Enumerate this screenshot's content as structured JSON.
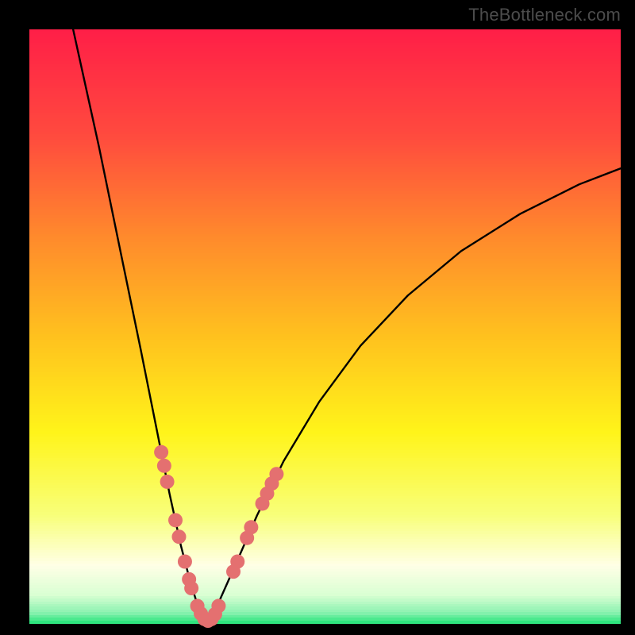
{
  "watermark": "TheBottleneck.com",
  "colors": {
    "frame": "#000000",
    "curve": "#000000",
    "dot": "#e47070",
    "bottom_bar": "#2fe57f"
  },
  "chart_data": {
    "type": "line",
    "title": "",
    "xlabel": "",
    "ylabel": "",
    "xlim": [
      0,
      100
    ],
    "ylim": [
      0,
      100
    ],
    "gradient_stops": [
      {
        "pos": 0.0,
        "color": "#ff1f47"
      },
      {
        "pos": 0.18,
        "color": "#ff4b3e"
      },
      {
        "pos": 0.35,
        "color": "#ff8a2c"
      },
      {
        "pos": 0.52,
        "color": "#ffc21e"
      },
      {
        "pos": 0.68,
        "color": "#fff41a"
      },
      {
        "pos": 0.82,
        "color": "#f8ff7a"
      },
      {
        "pos": 0.905,
        "color": "#ffffe6"
      },
      {
        "pos": 0.955,
        "color": "#d9ffd3"
      },
      {
        "pos": 0.985,
        "color": "#8af2b0"
      },
      {
        "pos": 1.0,
        "color": "#2fe57f"
      }
    ],
    "series": [
      {
        "name": "left_branch",
        "points": [
          {
            "x": 7.4,
            "y": 100.0
          },
          {
            "x": 11.8,
            "y": 80.0
          },
          {
            "x": 15.5,
            "y": 62.0
          },
          {
            "x": 18.8,
            "y": 46.0
          },
          {
            "x": 21.5,
            "y": 32.5
          },
          {
            "x": 23.7,
            "y": 21.5
          },
          {
            "x": 25.6,
            "y": 12.8
          },
          {
            "x": 27.2,
            "y": 6.6
          },
          {
            "x": 28.4,
            "y": 2.8
          },
          {
            "x": 29.4,
            "y": 0.8
          },
          {
            "x": 30.0,
            "y": 0.0
          }
        ]
      },
      {
        "name": "right_branch",
        "points": [
          {
            "x": 30.0,
            "y": 0.0
          },
          {
            "x": 32.2,
            "y": 3.5
          },
          {
            "x": 35.0,
            "y": 9.8
          },
          {
            "x": 38.5,
            "y": 17.8
          },
          {
            "x": 43.0,
            "y": 27.0
          },
          {
            "x": 49.0,
            "y": 37.0
          },
          {
            "x": 56.0,
            "y": 46.5
          },
          {
            "x": 64.0,
            "y": 55.0
          },
          {
            "x": 73.0,
            "y": 62.5
          },
          {
            "x": 83.0,
            "y": 68.8
          },
          {
            "x": 93.0,
            "y": 73.8
          },
          {
            "x": 100.0,
            "y": 76.5
          }
        ]
      }
    ],
    "dots": [
      {
        "x": 22.3,
        "y": 28.5
      },
      {
        "x": 22.8,
        "y": 26.2
      },
      {
        "x": 23.3,
        "y": 23.5
      },
      {
        "x": 24.7,
        "y": 17.0
      },
      {
        "x": 25.3,
        "y": 14.2
      },
      {
        "x": 26.3,
        "y": 10.0
      },
      {
        "x": 27.0,
        "y": 7.0
      },
      {
        "x": 27.4,
        "y": 5.5
      },
      {
        "x": 28.4,
        "y": 2.5
      },
      {
        "x": 29.0,
        "y": 1.2
      },
      {
        "x": 29.6,
        "y": 0.3
      },
      {
        "x": 30.2,
        "y": 0.0
      },
      {
        "x": 30.8,
        "y": 0.3
      },
      {
        "x": 31.4,
        "y": 1.1
      },
      {
        "x": 32.0,
        "y": 2.5
      },
      {
        "x": 34.5,
        "y": 8.3
      },
      {
        "x": 35.2,
        "y": 10.0
      },
      {
        "x": 36.8,
        "y": 14.0
      },
      {
        "x": 37.5,
        "y": 15.8
      },
      {
        "x": 39.4,
        "y": 19.8
      },
      {
        "x": 40.2,
        "y": 21.5
      },
      {
        "x": 41.0,
        "y": 23.2
      },
      {
        "x": 41.8,
        "y": 24.8
      }
    ]
  }
}
